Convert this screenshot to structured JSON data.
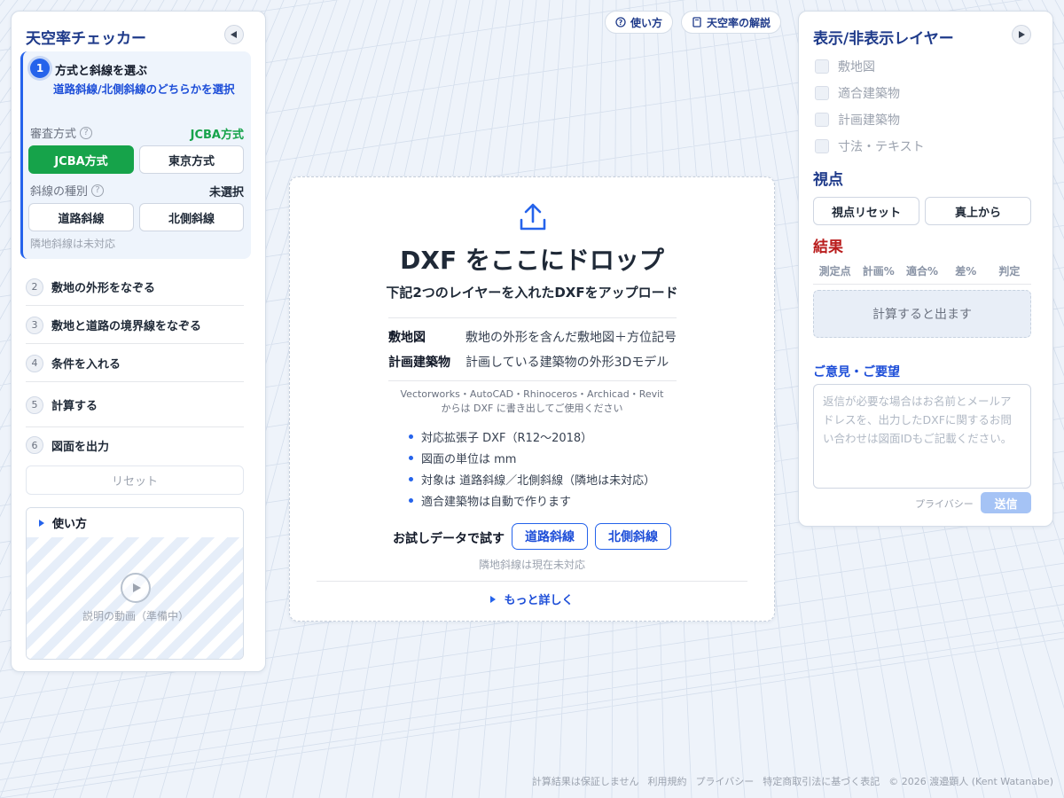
{
  "app": {
    "title": "天空率チェッカー"
  },
  "header_links": {
    "howto": "使い方",
    "explain": "天空率の解説"
  },
  "left_panel": {
    "step1": {
      "number": "1",
      "title": "方式と斜線を選ぶ",
      "desc": "道路斜線/北側斜線のどちらかを選択",
      "review_label": "審査方式",
      "review_value": "JCBA方式",
      "jcba_button": "JCBA方式",
      "tokyo_button": "東京方式",
      "slope_label": "斜線の種別",
      "slope_value": "未選択",
      "road_button": "道路斜線",
      "north_button": "北側斜線",
      "note": "隣地斜線は未対応"
    },
    "steps": [
      {
        "number": "2",
        "label": "敷地の外形をなぞる"
      },
      {
        "number": "3",
        "label": "敷地と道路の境界線をなぞる"
      },
      {
        "number": "4",
        "label": "条件を入れる"
      },
      {
        "number": "5",
        "label": "計算する"
      },
      {
        "number": "6",
        "label": "図面を出力"
      }
    ],
    "reset": "リセット",
    "howto": {
      "title": "使い方",
      "video_label": "説明の動画（準備中）"
    }
  },
  "drop_zone": {
    "title": "DXF をここにドロップ",
    "subtitle": "下記2つのレイヤーを入れたDXFをアップロード",
    "layers": [
      {
        "name": "敷地図",
        "desc": "敷地の外形を含んだ敷地図＋方位記号"
      },
      {
        "name": "計画建築物",
        "desc": "計画している建築物の外形3Dモデル"
      }
    ],
    "software_line1": "Vectorworks・AutoCAD・Rhinoceros・Archicad・Revit",
    "software_line2": "からは DXF に書き出してご使用ください",
    "bullets": [
      "対応拡張子 DXF（R12〜2018）",
      "図面の単位は mm",
      "対象は 道路斜線／北側斜線（隣地は未対応）",
      "適合建築物は自動で作ります"
    ],
    "try_label": "お試しデータで試す",
    "try_road": "道路斜線",
    "try_north": "北側斜線",
    "note": "隣地斜線は現在未対応",
    "more": "もっと詳しく"
  },
  "right_panel": {
    "layers_title": "表示/非表示レイヤー",
    "layers": [
      "敷地図",
      "適合建築物",
      "計画建築物",
      "寸法・テキスト"
    ],
    "view_title": "視点",
    "view_reset": "視点リセット",
    "view_top": "真上から",
    "result_title": "結果",
    "result_columns": [
      "測定点",
      "計画%",
      "適合%",
      "差%",
      "判定"
    ],
    "result_empty": "計算すると出ます",
    "feedback_title": "ご意見・ご要望",
    "feedback_placeholder": "返信が必要な場合はお名前とメールアドレスを、出力したDXFに関するお問い合わせは図面IDもご記載ください。",
    "privacy": "プライバシー",
    "send": "送信"
  },
  "footer": {
    "links": [
      "計算結果は保証しません",
      "利用規約",
      "プライバシー",
      "特定商取引法に基づく表記"
    ],
    "copyright": "© 2026 渡邉顕人 (Kent Watanabe)"
  },
  "colors": {
    "accent": "#2563eb",
    "title": "#1e3a8a",
    "green": "#16a34a",
    "result_red": "#b91c1c",
    "background": "#eef3fa"
  }
}
